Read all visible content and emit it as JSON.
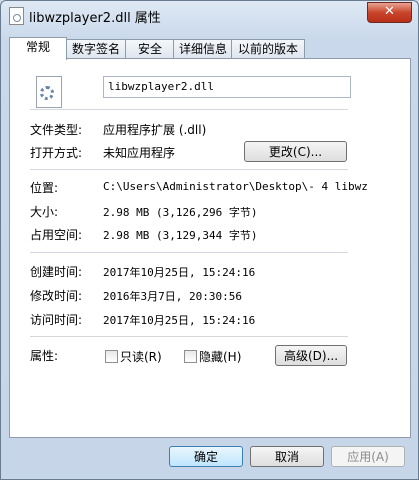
{
  "window": {
    "title": "libwzplayer2.dll 属性",
    "close_label": "✕"
  },
  "tabs": [
    "常规",
    "数字签名",
    "安全",
    "详细信息",
    "以前的版本"
  ],
  "general": {
    "file_name": "libwzplayer2.dll",
    "file_type": {
      "label": "文件类型:",
      "value": "应用程序扩展 (.dll)"
    },
    "opens_with": {
      "label": "打开方式:",
      "value": "未知应用程序",
      "button": "更改(C)..."
    },
    "location": {
      "label": "位置:",
      "value": "C:\\Users\\Administrator\\Desktop\\- 4 libwz"
    },
    "size": {
      "label": "大小:",
      "value": "2.98 MB (3,126,296 字节)"
    },
    "size_on_disk": {
      "label": "占用空间:",
      "value": "2.98 MB (3,129,344 字节)"
    },
    "created": {
      "label": "创建时间:",
      "value": "2017年10月25日, 15:24:16"
    },
    "modified": {
      "label": "修改时间:",
      "value": "2016年3月7日, 20:30:56"
    },
    "accessed": {
      "label": "访问时间:",
      "value": "2017年10月25日, 15:24:16"
    },
    "attributes": {
      "label": "属性:",
      "readonly": "只读(R)",
      "hidden": "隐藏(H)",
      "advanced": "高级(D)..."
    }
  },
  "footer": {
    "ok": "确定",
    "cancel": "取消",
    "apply": "应用(A)"
  }
}
